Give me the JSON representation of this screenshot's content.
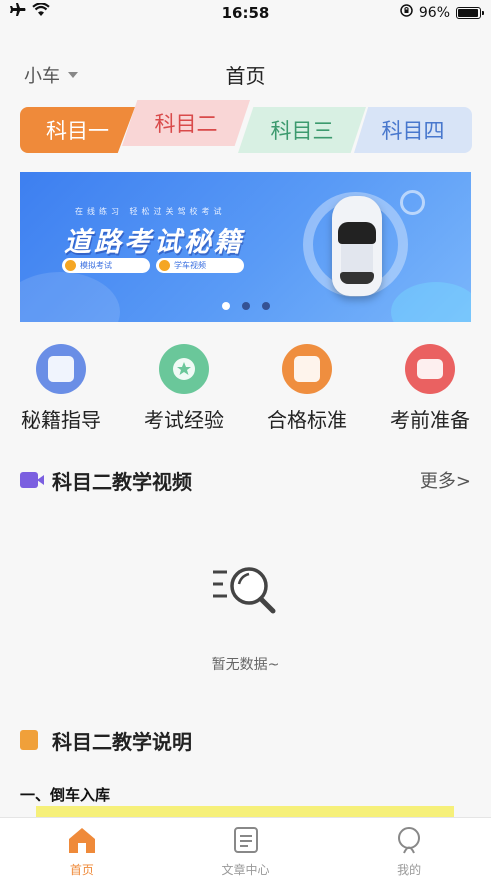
{
  "status_bar": {
    "time": "16:58",
    "battery": "96%",
    "battery_level": 0.96
  },
  "header": {
    "car_type": "小车",
    "title": "首页"
  },
  "subject_tabs": [
    {
      "label": "科目一",
      "color": "#ef8a3a"
    },
    {
      "label": "科目二",
      "color": "#d94a4a"
    },
    {
      "label": "科目三",
      "color": "#3c9a6e"
    },
    {
      "label": "科目四",
      "color": "#4877cd"
    }
  ],
  "banner": {
    "subtitle": "在线练习 轻松过关驾校考试",
    "title": "道路考试秘籍",
    "pill_1": "模拟考试",
    "pill_2": "学车视频",
    "page_count": 3,
    "active_page": 1
  },
  "quick_entries": [
    {
      "label": "秘籍指导",
      "icon": "book-icon"
    },
    {
      "label": "考试经验",
      "icon": "star-icon"
    },
    {
      "label": "合格标准",
      "icon": "document-icon"
    },
    {
      "label": "考前准备",
      "icon": "monitor-icon"
    }
  ],
  "video_section": {
    "title": "科目二教学视频",
    "more": "更多>",
    "empty_text": "暂无数据~"
  },
  "guide_section": {
    "title": "科目二教学说明",
    "first_item": "一、倒车入库"
  },
  "tabbar": [
    {
      "label": "首页",
      "icon": "home-icon",
      "active": true
    },
    {
      "label": "文章中心",
      "icon": "article-icon",
      "active": false
    },
    {
      "label": "我的",
      "icon": "user-icon",
      "active": false
    }
  ]
}
